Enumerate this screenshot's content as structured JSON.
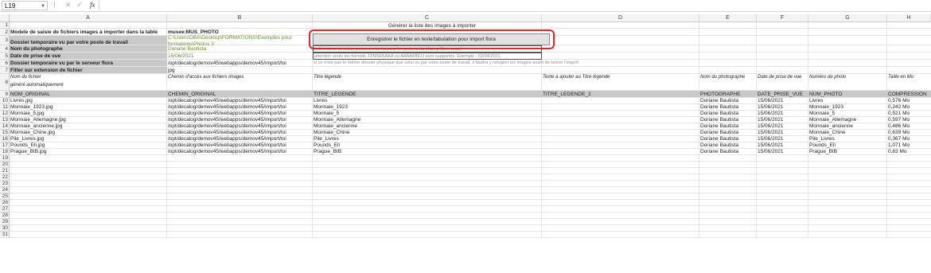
{
  "formula_bar": {
    "name_box": "L19",
    "cancel_icon": "✕",
    "enter_icon": "✓",
    "fx_label": "fx",
    "formula": ""
  },
  "columns": [
    "A",
    "B",
    "C",
    "D",
    "E",
    "F",
    "G",
    "H"
  ],
  "rows": [
    "1",
    "2",
    "3",
    "4",
    "5",
    "6",
    "7",
    "8",
    "9",
    "10",
    "11",
    "12",
    "13",
    "14",
    "15",
    "16",
    "17",
    "18",
    "19",
    "20",
    "21",
    "22",
    "23",
    "24",
    "25",
    "26",
    "27",
    "28",
    "29",
    "30",
    "31"
  ],
  "buttons": {
    "generate": "Générer la liste des images à importer",
    "save": "Enregistrer le fichier en texte/tabulation pour import flora"
  },
  "form": {
    "model_label": "Modele de saisie de fichiers images à importer dans la table",
    "model_value": "musee:MUS_PHOTO",
    "temp_dir_label": "Dossier temporaire vu par votre poste de travail",
    "temp_dir_value_1": "C:\\Users\\DBA\\Desktop\\FORMATIONS\\Exemples pour",
    "temp_dir_value_2": "formations\\Photos 3",
    "photographer_label": "Nom du photographe",
    "photographer_value": "Doriane Bautista",
    "photographer_note": "le lien avec la notice personne se fera sur le contenu du champ Nom usuel",
    "date_label": "Date de prise de vue",
    "date_value": "15/06/2021",
    "date_note": "attention seuls les formats JJ/MM/AAAA ou AAAAMMJJ sont supportés. Exemple : 03/04/2021",
    "server_dir_label": "Dossier temporaire vu par le serveur flora",
    "server_dir_value": "/opt/decalog/demov45/webapps/demov45/import/toi",
    "server_dir_note": "si ce n'est pas le même dossier physique que celui vu par votre poste de travail, il faudra y recopier les images avant de lancer l'import",
    "filter_label": "Filter sur extension de fichier",
    "filter_value": "jpg"
  },
  "descriptions": [
    "Nom du fichier",
    "Chemin d'accès aux fichiers images",
    "Titre légende",
    "Texte à ajouter au Titre légende",
    "Nom du photographe",
    "Date de prise de vue",
    "Numéro de photo",
    "Taille en Mo"
  ],
  "descriptions_extra": "généré automatiquement",
  "headers": [
    "NOM_ORIGINAL",
    "CHEMIN_ORIGINAL",
    "TITRE_LEGENDE",
    "TITRE_LEGENDE_2",
    "PHOTOGRAPHE",
    "DATE_PRISE_VUE",
    "NUM_PHOTO",
    "COMPRESSION"
  ],
  "data_rows": [
    [
      "Livres.jpg",
      "/opt/decalog/demov45/webapps/demov45/import/toi",
      "Livres",
      "",
      "Doriane Bautista",
      "15/06/2021",
      "Livres",
      "0,576 Mo"
    ],
    [
      "Monnaie_1923.jpg",
      "/opt/decalog/demov45/webapps/demov45/import/toi",
      "Monnaie_1923",
      "",
      "Doriane Bautista",
      "15/06/2021",
      "Monnaie_1923",
      "0,242 Mo"
    ],
    [
      "Monnaie_5.jpg",
      "/opt/decalog/demov45/webapps/demov45/import/toi",
      "Monnaie_5",
      "",
      "Doriane Bautista",
      "15/06/2021",
      "Monnaie_5",
      "0,521 Mo"
    ],
    [
      "Monnaie_Allemagne.jpg",
      "/opt/decalog/demov45/webapps/demov45/import/toi",
      "Monnaie_Allemagne",
      "",
      "Doriane Bautista",
      "15/06/2021",
      "Monnaie_Allemagne",
      "0,597 Mo"
    ],
    [
      "Monnaie_ancienne.jpg",
      "/opt/decalog/demov45/webapps/demov45/import/toi",
      "Monnaie_ancienne",
      "",
      "Doriane Bautista",
      "15/06/2021",
      "Monnaie_ancienne",
      "0,486 Mo"
    ],
    [
      "Monnaie_Chine.jpg",
      "/opt/decalog/demov45/webapps/demov45/import/toi",
      "Monnaie_Chine",
      "",
      "Doriane Bautista",
      "15/06/2021",
      "Monnaie_Chine",
      "0,639 Mo"
    ],
    [
      "Pile_Livres.jpg",
      "/opt/decalog/demov45/webapps/demov45/import/toi",
      "Pile_Livres",
      "",
      "Doriane Bautista",
      "15/06/2021",
      "Pile_Livres",
      "0,367 Mo"
    ],
    [
      "Pounds_Ell.jpg",
      "/opt/decalog/demov45/webapps/demov45/import/toi",
      "Pounds_Ell",
      "",
      "Doriane Bautista",
      "15/06/2021",
      "Pounds_Ell",
      "1,071 Mo"
    ],
    [
      "Prague_BIB.jpg",
      "/opt/decalog/demov45/webapps/demov45/import/toi",
      "Prague_BIB",
      "",
      "Doriane Bautista",
      "15/06/2021",
      "Prague_BIB",
      "0,83 Mo"
    ]
  ],
  "colors": {
    "highlight": "#e3262b",
    "header_fill": "#c9c9c9",
    "green_text": "#6a8e2e"
  }
}
